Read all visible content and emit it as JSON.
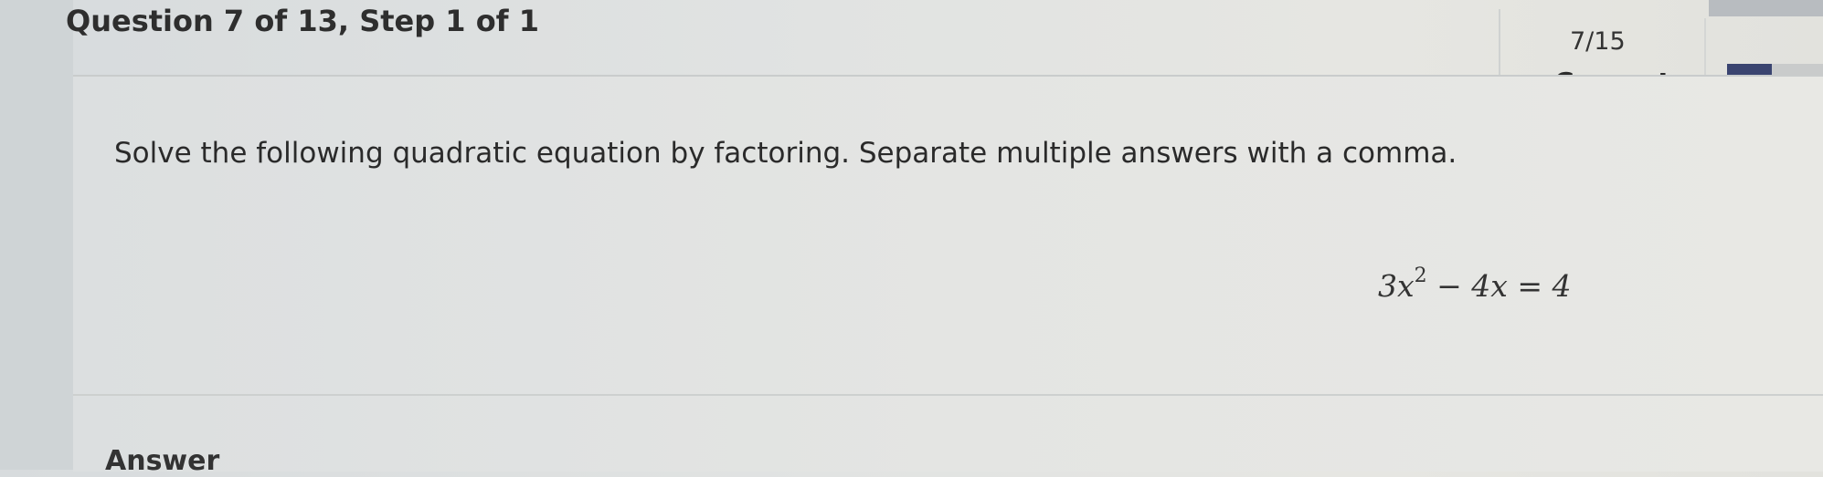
{
  "header": {
    "question_progress": "Question 7 of 13,  Step 1 of 1",
    "score": "7/15",
    "status": "Correct",
    "progress_fraction": 0.47
  },
  "question": {
    "prompt": "Solve the following quadratic equation by factoring. Separate multiple answers with a comma.",
    "equation_lhs_coeff_var": "3x",
    "equation_exponent": "2",
    "equation_rest": " − 4x = 4"
  },
  "answer": {
    "label": "Answer"
  },
  "colors": {
    "progress_fill": "#3a4470"
  }
}
